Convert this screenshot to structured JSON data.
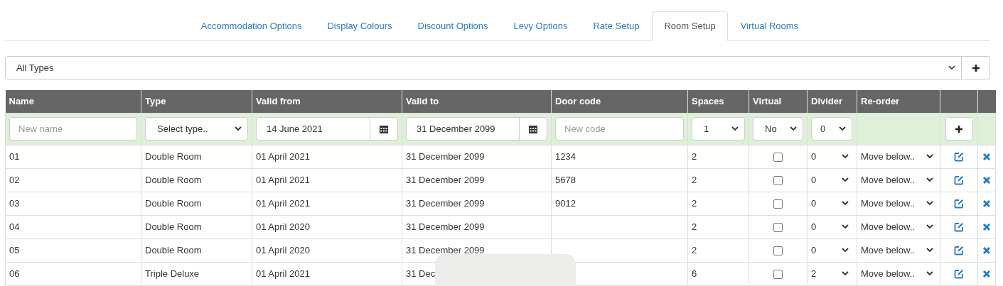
{
  "tabs": [
    {
      "label": "Accommodation Options",
      "selected": false
    },
    {
      "label": "Display Colours",
      "selected": false
    },
    {
      "label": "Discount Options",
      "selected": false
    },
    {
      "label": "Levy Options",
      "selected": false
    },
    {
      "label": "Rate Setup",
      "selected": false
    },
    {
      "label": "Room Setup",
      "selected": true
    },
    {
      "label": "Virtual Rooms",
      "selected": false
    }
  ],
  "type_filter": {
    "value": "All Types"
  },
  "table": {
    "columns": [
      "Name",
      "Type",
      "Valid from",
      "Valid to",
      "Door code",
      "Spaces",
      "Virtual",
      "Divider",
      "Re-order"
    ],
    "new_row": {
      "name_placeholder": "New name",
      "type": "Select type..",
      "valid_from": "14 June 2021",
      "valid_to": "31 December 2099",
      "door_code_placeholder": "New code",
      "spaces": "1",
      "virtual": "No",
      "divider": "0"
    },
    "rows": [
      {
        "name": "01",
        "type": "Double Room",
        "valid_from": "01 April 2021",
        "valid_to": "31 December 2099",
        "door_code": "1234",
        "spaces": "2",
        "virtual": false,
        "divider": "0",
        "reorder": "Move below.."
      },
      {
        "name": "02",
        "type": "Double Room",
        "valid_from": "01 April 2021",
        "valid_to": "31 December 2099",
        "door_code": "5678",
        "spaces": "2",
        "virtual": false,
        "divider": "0",
        "reorder": "Move below.."
      },
      {
        "name": "03",
        "type": "Double Room",
        "valid_from": "01 April 2021",
        "valid_to": "31 December 2099",
        "door_code": "9012",
        "spaces": "2",
        "virtual": false,
        "divider": "0",
        "reorder": "Move below.."
      },
      {
        "name": "04",
        "type": "Double Room",
        "valid_from": "01 April 2020",
        "valid_to": "31 December 2099",
        "spaces": "2",
        "virtual": false,
        "divider": "0",
        "reorder": "Move below.."
      },
      {
        "name": "05",
        "type": "Double Room",
        "valid_from": "01 April 2020",
        "valid_to": "31 December 2099",
        "spaces": "2",
        "virtual": false,
        "divider": "0",
        "reorder": "Move below.."
      },
      {
        "name": "06",
        "type": "Triple Deluxe",
        "valid_from": "01 April 2021",
        "valid_to": "31 Dec",
        "spaces": "6",
        "virtual": false,
        "divider": "2",
        "reorder": "Move below.."
      }
    ]
  }
}
